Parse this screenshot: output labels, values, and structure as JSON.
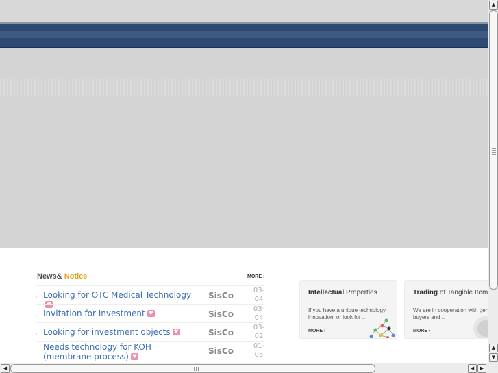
{
  "news": {
    "heading_main": "News&",
    "heading_accent": " Notice",
    "more_label": "MORE ›",
    "items": [
      {
        "title": "Looking for OTC Medical Technology",
        "author": "SisCo",
        "date": "03-04",
        "icon": "new-heart-icon"
      },
      {
        "title": "Invitation for Investment",
        "author": "SisCo",
        "date": "03-04",
        "icon": "new-heart-icon"
      },
      {
        "title": "Looking for investment objects",
        "author": "SisCo",
        "date": "03-02",
        "icon": "new-heart-icon"
      },
      {
        "title": "Needs technology for KOH (membrane process)",
        "author": "SisCo",
        "date": "01-05",
        "icon": "new-heart-icon"
      }
    ]
  },
  "cards": [
    {
      "title_bold": "Intellectual",
      "title_rest": " Properties",
      "desc": "If you have a unique technology innovation, or look for ..",
      "more_label": "MORE ›",
      "icon": "molecule-icon"
    },
    {
      "title_bold": "Trading",
      "title_rest": " of Tangible Item",
      "desc": "We are in cooperation with genuine buyers and ..",
      "more_label": "MORE ›",
      "icon": "globe-icon"
    }
  ],
  "scrollbars": {
    "up_icon": "arrow-up-icon",
    "down_icon": "arrow-down-icon",
    "left_icon": "arrow-left-icon",
    "right_icon": "arrow-right-icon"
  },
  "colors": {
    "nav_bar": "#2d4a73",
    "link": "#3e6fb0",
    "accent": "#e7a01a",
    "new_badge": "#f08fa8"
  }
}
